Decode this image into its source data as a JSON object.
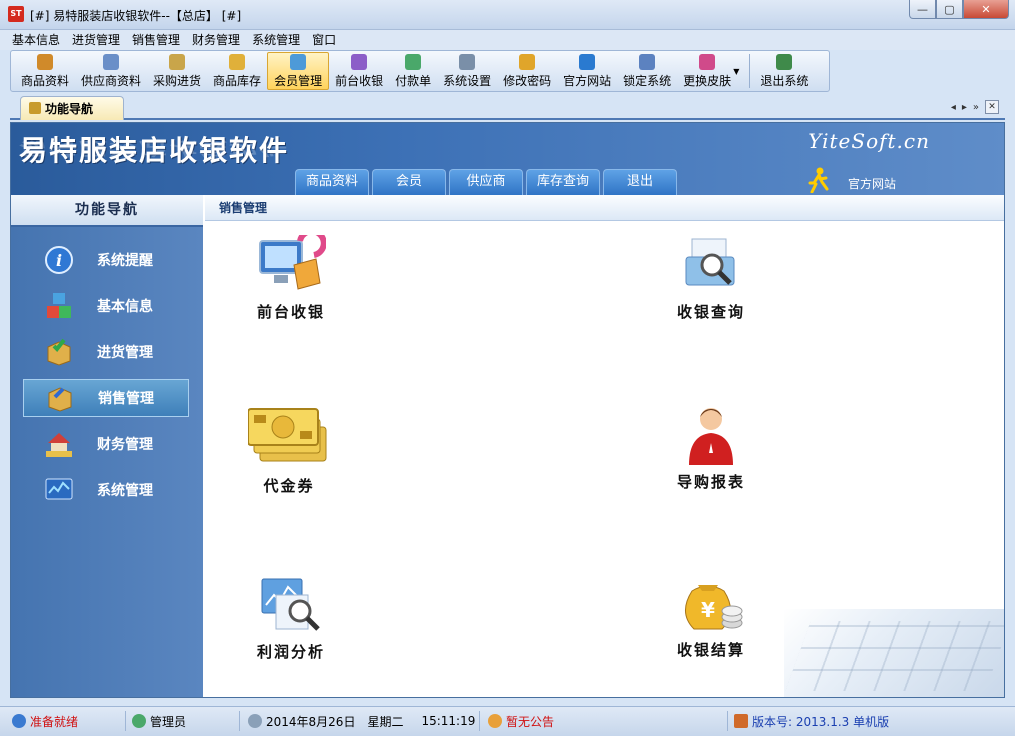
{
  "window": {
    "title": "[#] 易特服装店收银软件--【总店】 [#]",
    "app_icon_text": "ST",
    "controls": {
      "minimize": "—",
      "maximize": "▢",
      "close": "✕"
    }
  },
  "menu": [
    "基本信息",
    "进货管理",
    "销售管理",
    "财务管理",
    "系统管理",
    "窗口"
  ],
  "toolbar": [
    {
      "label": "商品资料",
      "icon": "product-icon",
      "color": "#d08a2a"
    },
    {
      "label": "供应商资料",
      "icon": "supplier-icon",
      "color": "#6a8fc8"
    },
    {
      "label": "采购进货",
      "icon": "truck-icon",
      "color": "#c9a54a"
    },
    {
      "label": "商品库存",
      "icon": "stock-icon",
      "color": "#e0b03a"
    },
    {
      "label": "会员管理",
      "icon": "member-icon",
      "color": "#4d9ad8"
    },
    {
      "label": "前台收银",
      "icon": "cashier-icon",
      "color": "#8c5ec8"
    },
    {
      "label": "付款单",
      "icon": "payment-icon",
      "color": "#4aa86a"
    },
    {
      "label": "系统设置",
      "icon": "settings-icon",
      "color": "#7a8fa8"
    },
    {
      "label": "修改密码",
      "icon": "key-icon",
      "color": "#e0a52a"
    },
    {
      "label": "官方网站",
      "icon": "ie-icon",
      "color": "#2a7ad0"
    },
    {
      "label": "锁定系统",
      "icon": "lock-icon",
      "color": "#5c82c0"
    },
    {
      "label": "更换皮肤",
      "icon": "palette-icon",
      "color": "#d04a8a"
    },
    {
      "label": "退出系统",
      "icon": "exit-icon",
      "color": "#3f8a4a"
    }
  ],
  "tabs": {
    "active": "功能导航",
    "nav_left": "◂",
    "nav_right": "▸",
    "nav_more": "»",
    "close": "✕"
  },
  "banner": {
    "title": "易特服装店收银软件",
    "brand": "YiteSoft.cn",
    "tabs": [
      "商品资料",
      "会员",
      "供应商",
      "库存查询",
      "退出"
    ],
    "official_site": "官方网站"
  },
  "sidenav": {
    "heading": "功能导航",
    "items": [
      {
        "label": "系统提醒",
        "icon": "info-icon"
      },
      {
        "label": "基本信息",
        "icon": "cubes-icon"
      },
      {
        "label": "进货管理",
        "icon": "box-in-icon"
      },
      {
        "label": "销售管理",
        "icon": "box-out-icon"
      },
      {
        "label": "财务管理",
        "icon": "house-money-icon"
      },
      {
        "label": "系统管理",
        "icon": "monitor-chart-icon"
      }
    ]
  },
  "content": {
    "heading": "销售管理",
    "functions": [
      {
        "label": "前台收银",
        "icon": "pos-computer-icon"
      },
      {
        "label": "收银查询",
        "icon": "search-docs-icon"
      },
      {
        "label": "代金券",
        "icon": "voucher-icon"
      },
      {
        "label": "导购报表",
        "icon": "salesperson-icon"
      },
      {
        "label": "利润分析",
        "icon": "profit-chart-icon"
      },
      {
        "label": "收银结算",
        "icon": "money-bag-icon"
      }
    ]
  },
  "status": {
    "state": "准备就绪",
    "user": "管理员",
    "date": "2014年8月26日",
    "weekday": "星期二",
    "time": "15:11:19",
    "notice": "暂无公告",
    "version": "版本号: 2013.1.3 单机版"
  },
  "colors": {
    "accent": "#3d71b6",
    "sidebar": "#4d7cb8",
    "active_tool": "#ffd35c",
    "status_red": "#d01010",
    "status_blue": "#1a3fb0"
  }
}
